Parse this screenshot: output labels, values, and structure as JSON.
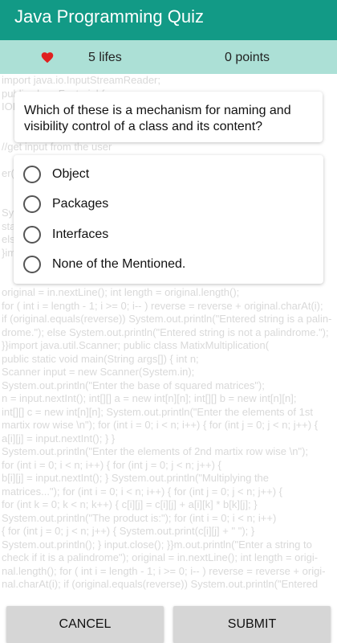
{
  "app": {
    "title": "Java Programming Quiz"
  },
  "score": {
    "lives": "5 lifes",
    "points": "0  points",
    "heart_color": "#e0201f"
  },
  "question": {
    "text": "Which of these is a mechanism for naming and visibility control of a class and its content?"
  },
  "options": [
    {
      "label": "Object"
    },
    {
      "label": "Packages"
    },
    {
      "label": "Interfaces"
    },
    {
      "label": "None of the Mentioned."
    }
  ],
  "buttons": {
    "cancel": "CANCEL",
    "submit": "SUBMIT"
  },
  "background_code": [
    "import java.io.InputStreamReader;",
    "public class Factorial {",
    "IOE",
    "",
    "",
    "         //get input from the user",
    "",
    "er(",
    "",
    "",
    "   Sy",
    "   sta",
    "   else",
    "  }im",
    "",
    "",
    "    original = in.nextLine();      int length = original.length();",
    "    for ( int i = length - 1; i >= 0; i-- )   reverse = reverse + original.charAt(i);",
    "    if (original.equals(reverse)) System.out.println(\"Entered string is a palin-",
    "drome.\");    else     System.out.println(\"Entered string is not a palindrome.\");",
    "}}import java.util.Scanner; public class MatixMultiplication(",
    "    public static void main(String args[])    {       int n;",
    "      Scanner input = new Scanner(System.in);",
    "      System.out.println(\"Enter the base of squared matrices\");",
    "      n = input.nextInt();    int[][] a = new int[n][n];    int[][] b = new int[n][n];",
    "      int[][] c = new int[n][n];    System.out.println(\"Enter the elements of 1st",
    "martix row wise \\n\");   for (int i = 0; i < n; i++)       {    for (int j = 0; j < n; j++) {",
    "            a[i][j] = input.nextInt();    }    }",
    "      System.out.println(\"Enter the elements of 2nd martix row wise \\n\");",
    "      for (int i = 0; i < n; i++)       {      for (int j = 0; j < n; j++)       {",
    "               b[i][j] = input.nextInt();     }   System.out.println(\"Multiplying the",
    "matrices...\");    for (int i = 0; i < n; i++)        {  for (int j = 0; j < n; j++)     {",
    "            for (int k = 0; k < n; k++)    {     c[i][j] = c[i][j] + a[i][k] * b[k][j];     }",
    "      System.out.println(\"The product is:\");    for (int i = 0; i < n; i++)",
    "      {         for (int j = 0; j < n; j++)    { System.out.print(c[i][j] + \" \");         }",
    "    System.out.println();    }    input.close();    }}m.out.println(\"Enter a string to",
    "check if it is a palindrome\");      original = in.nextLine();      int length = origi-",
    "nal.length();      for ( int i = length - 1; i >= 0; i-- )   reverse = reverse + origi-",
    "nal.charAt(i);     if (original.equals(reverse)) System.out.println(\"Entered"
  ]
}
